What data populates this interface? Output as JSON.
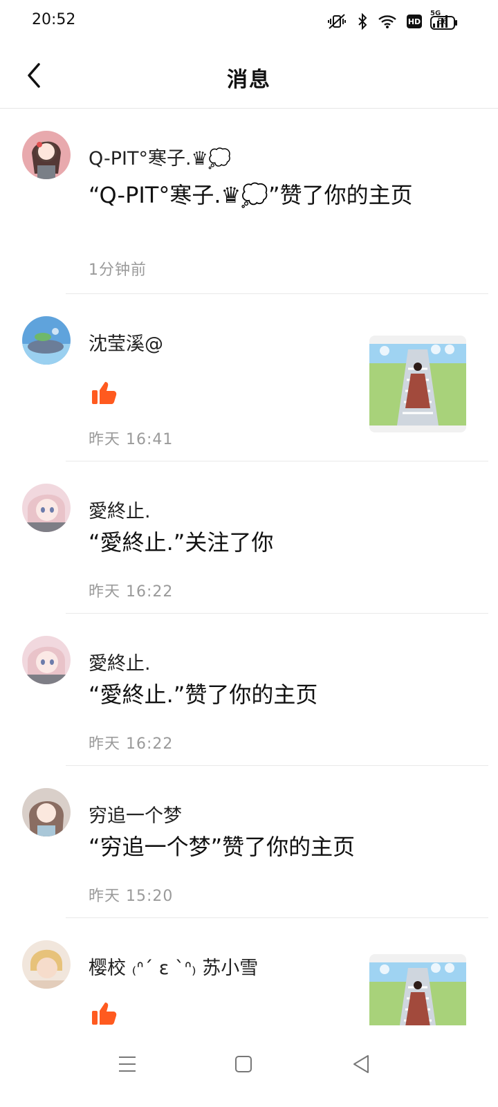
{
  "status_bar": {
    "time": "20:52",
    "icons": [
      "mute-vibrate-icon",
      "bluetooth-icon",
      "wifi-icon",
      "hd-icon",
      "5g-signal-icon",
      "battery-icon"
    ],
    "hd_label": "HD",
    "network_label": "5G",
    "battery_level": "56"
  },
  "header": {
    "title": "消息",
    "back_icon": "chevron-left-icon"
  },
  "notifications": [
    {
      "name": "Q-PIT°寒子.♛💭",
      "message": "“Q-PIT°寒子.♛💭”赞了你的主页",
      "time": "1分钟前"
    },
    {
      "name": "沈莹溪@",
      "action_icon": "thumbs-up-icon",
      "time": "昨天 16:41",
      "has_thumbnail": true
    },
    {
      "name": "愛終止.",
      "message": "“愛終止.”关注了你",
      "time": "昨天 16:22"
    },
    {
      "name": "愛終止.",
      "message": "“愛終止.”赞了你的主页",
      "time": "昨天 16:22"
    },
    {
      "name": "穷追一个梦",
      "message": "“穷追一个梦”赞了你的主页",
      "time": "昨天 15:20"
    },
    {
      "name": "樱校 ₍ᐢ´ ε `ᐢ₎ 苏小雪",
      "action_icon": "thumbs-up-icon",
      "has_thumbnail": true
    }
  ],
  "colors": {
    "like_orange": "#ff5a1f",
    "time_gray": "#9a9a9a",
    "divider": "#e9e9e9"
  },
  "nav_bar": {
    "icons": [
      "menu-icon",
      "home-square-icon",
      "back-triangle-icon"
    ]
  }
}
